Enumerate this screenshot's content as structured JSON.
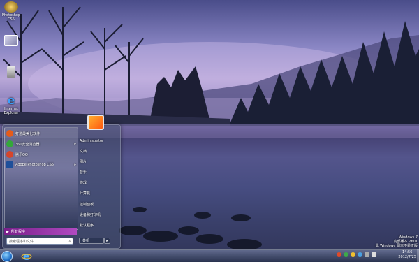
{
  "desktop": {
    "icons": [
      {
        "label": "Photoshop CS5",
        "icon": "photoshop-app-icon"
      },
      {
        "label": "",
        "icon": "monitor-icon"
      },
      {
        "label": "",
        "icon": "recycle-bin-icon"
      },
      {
        "label": "Internet Explorer",
        "icon": "ie-icon"
      }
    ]
  },
  "start_menu": {
    "programs": [
      {
        "label": "打造最美化软件",
        "icon": "green-app-icon",
        "color": "#e55b1a",
        "has_arrow": false
      },
      {
        "label": "360安全浏览器",
        "icon": "browser-360-icon",
        "color": "#34a83a",
        "has_arrow": true
      },
      {
        "label": "腾讯QQ",
        "icon": "qq-icon",
        "color": "#d6452b",
        "has_arrow": false
      },
      {
        "label": "Adobe Photoshop CS5",
        "icon": "photoshop-icon",
        "color": "#1e4f9a",
        "has_arrow": true
      }
    ],
    "all_programs": "所有程序",
    "search_placeholder": "搜索程序和文件",
    "user_name": "Administrator",
    "right_items": [
      "文档",
      "图片",
      "音乐",
      "游戏",
      "计算机",
      "控制面板",
      "设备和打印机",
      "默认程序"
    ],
    "shutdown": "关机"
  },
  "taskbar": {
    "start_icon": "windows-orb-icon",
    "pinned": [
      "ie-taskbar-icon"
    ],
    "tray_icons": [
      "flag-icon",
      "network-icon",
      "security-icon",
      "update-icon",
      "network-icon",
      "volume-icon"
    ],
    "clock_time": "14:56",
    "clock_date": "2012/7/25"
  },
  "watermark": {
    "line1": "Windows 7",
    "line2": "内部版本 7601",
    "line3": "此 Windows 副本不是正版"
  },
  "colors": {
    "all_programs_bar": "#9a35b0",
    "avatar": "#ff7a20"
  }
}
